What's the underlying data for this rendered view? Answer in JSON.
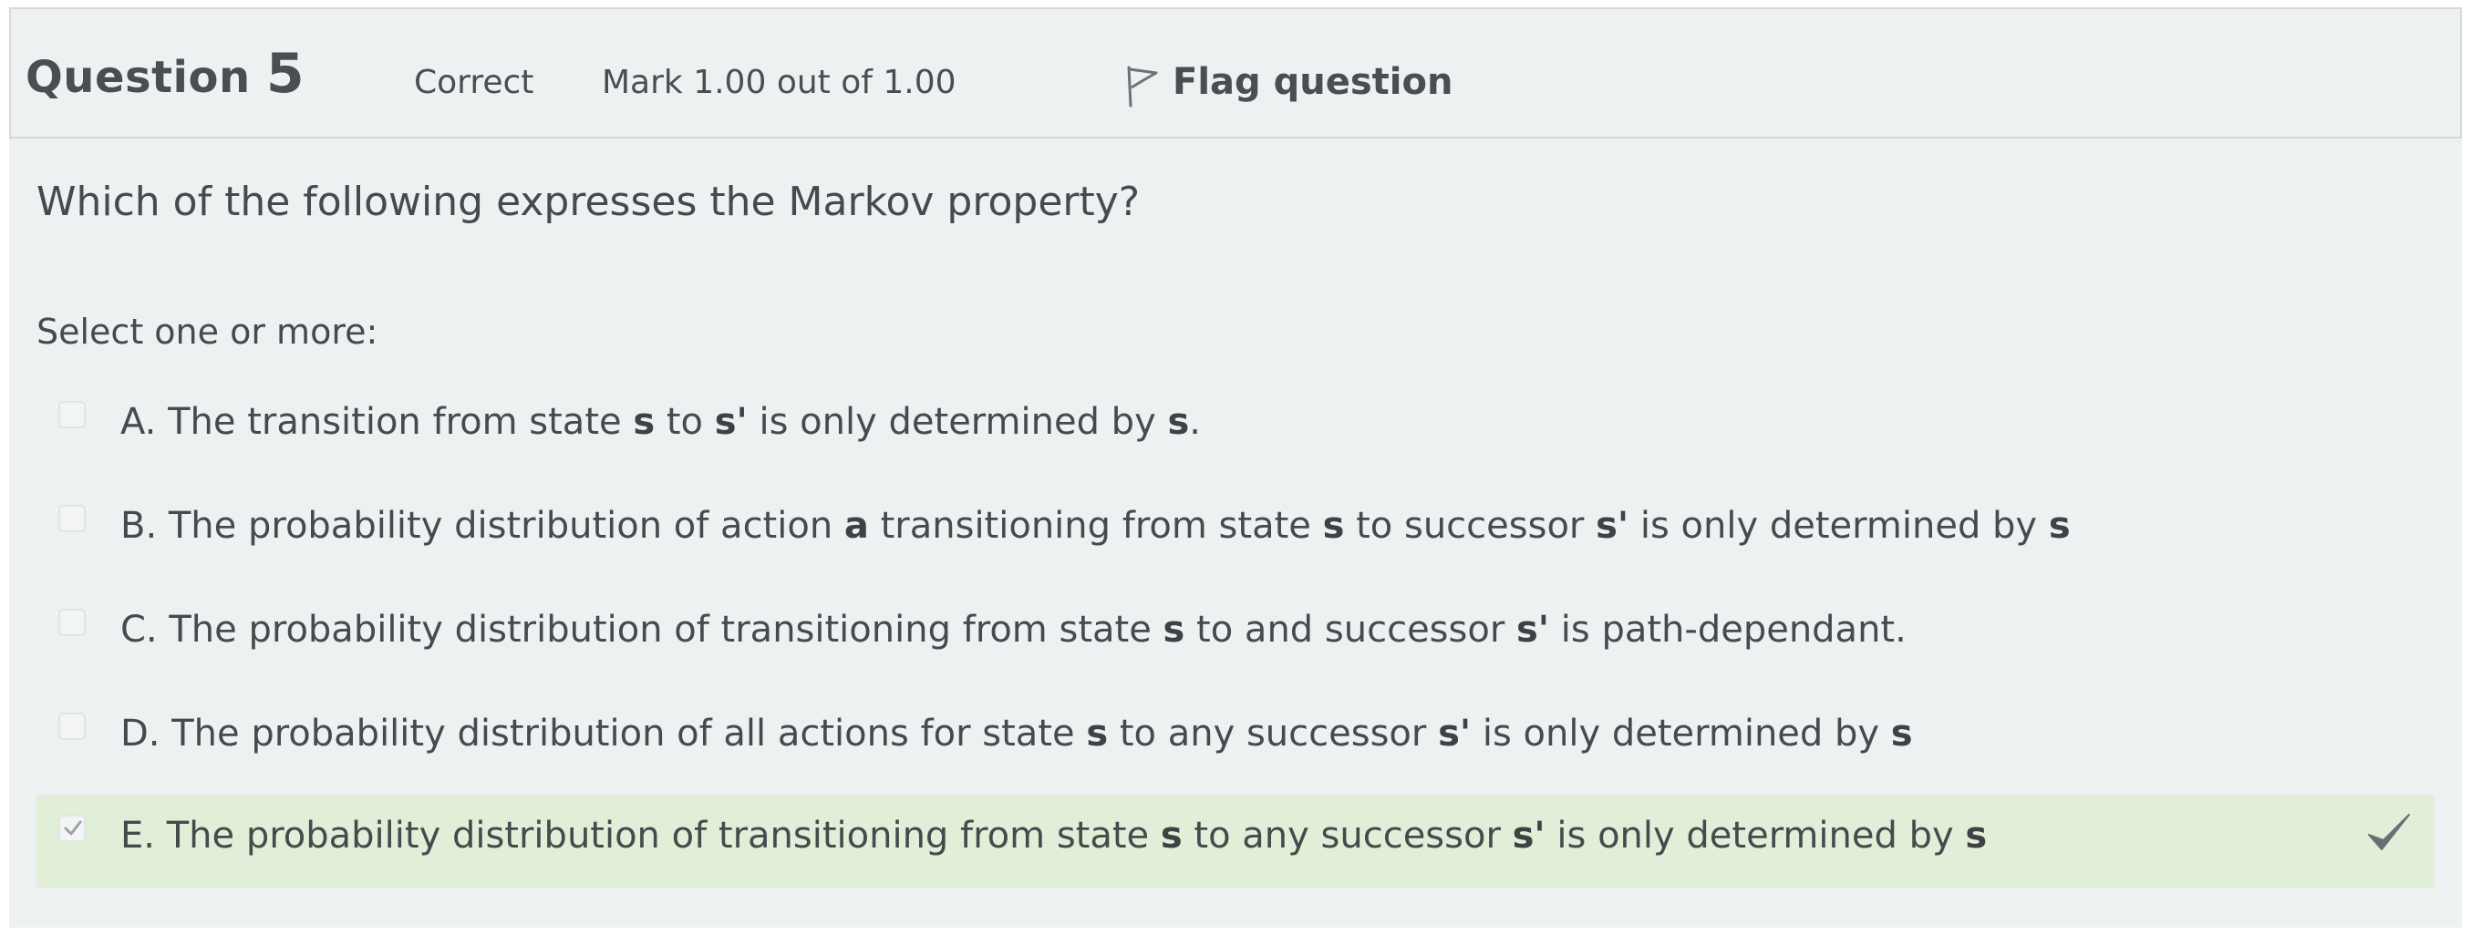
{
  "question": {
    "label": "Question",
    "number": "5",
    "state": "Correct",
    "grade": "Mark 1.00 out of 1.00",
    "flag_label": "Flag question",
    "flag_icon": "flag-outline-icon",
    "text": "Which of the following expresses the Markov property?",
    "prompt": "Select one or more:"
  },
  "options": [
    {
      "letter": "A.",
      "parts": [
        "The transition from state ",
        "s",
        " to ",
        "s'",
        " is only determined by ",
        "s",
        "."
      ],
      "checked": false
    },
    {
      "letter": "B.",
      "parts": [
        "The probability distribution of action ",
        "a",
        " transitioning from state ",
        "s",
        " to successor ",
        "s'",
        " is only determined by ",
        "s"
      ],
      "checked": false
    },
    {
      "letter": "C.",
      "parts": [
        "The probability distribution of transitioning from state ",
        "s",
        " to and successor ",
        "s'",
        " is path-dependant."
      ],
      "checked": false
    },
    {
      "letter": "D.",
      "parts": [
        "The probability distribution of all actions for state ",
        "s",
        " to any successor ",
        "s'",
        " is only determined by ",
        "s"
      ],
      "checked": false
    },
    {
      "letter": "E.",
      "parts": [
        "The probability distribution of transitioning from state ",
        "s",
        " to any successor ",
        "s'",
        " is only determined by ",
        "s"
      ],
      "checked": true,
      "correct": true,
      "status_icon": "checkmark-icon"
    }
  ],
  "colors": {
    "panel": "#eef1f2",
    "correct_background": "#e1efd9",
    "text": "#464a4c"
  }
}
